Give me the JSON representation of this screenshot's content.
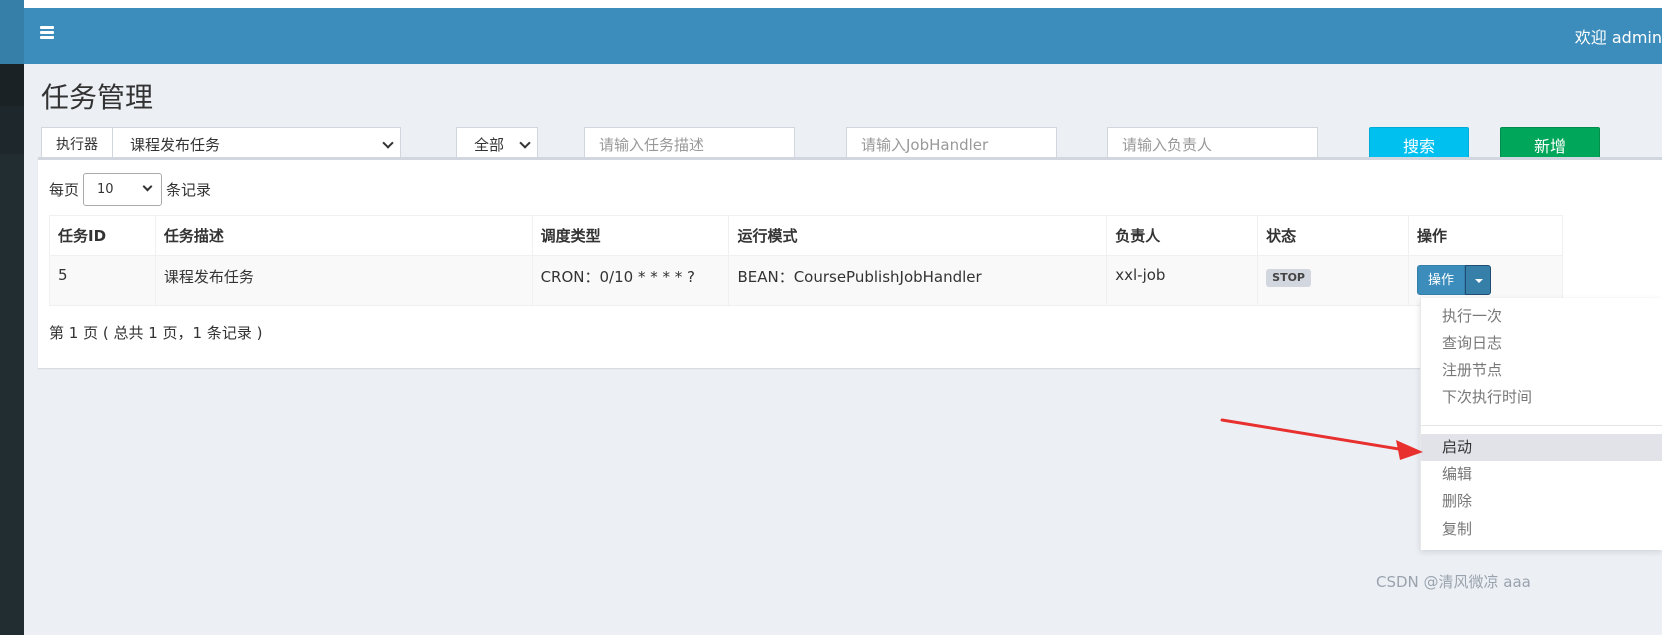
{
  "header": {
    "welcome": "欢迎 admin"
  },
  "page": {
    "title": "任务管理"
  },
  "filters": {
    "executor_label": "执行器",
    "executor_value": "课程发布任务",
    "status_value": "全部",
    "desc_placeholder": "请输入任务描述",
    "handler_placeholder": "请输入JobHandler",
    "author_placeholder": "请输入负责人",
    "search_label": "搜索",
    "add_label": "新增"
  },
  "table_length": {
    "prefix": "每页",
    "value": "10",
    "suffix": "条记录"
  },
  "table": {
    "columns": [
      "任务ID",
      "任务描述",
      "调度类型",
      "运行模式",
      "负责人",
      "状态",
      "操作"
    ],
    "rows": [
      {
        "id": "5",
        "desc": "课程发布任务",
        "schedule": "CRON：0/10 * * * * ?",
        "mode": "BEAN：CoursePublishJobHandler",
        "author": "xxl-job",
        "status": "STOP",
        "op_label": "操作"
      }
    ]
  },
  "pagination": {
    "info": "第 1 页 ( 总共 1 页，1 条记录 )"
  },
  "dropdown": {
    "items": [
      "执行一次",
      "查询日志",
      "注册节点",
      "下次执行时间",
      "启动",
      "编辑",
      "删除",
      "复制"
    ],
    "active": "启动"
  },
  "watermark": "CSDN @清风微凉 aaa",
  "colors": {
    "primary": "#3c8dbc",
    "info": "#00c0ef",
    "success": "#00a65a",
    "arrow": "#e8302e"
  }
}
